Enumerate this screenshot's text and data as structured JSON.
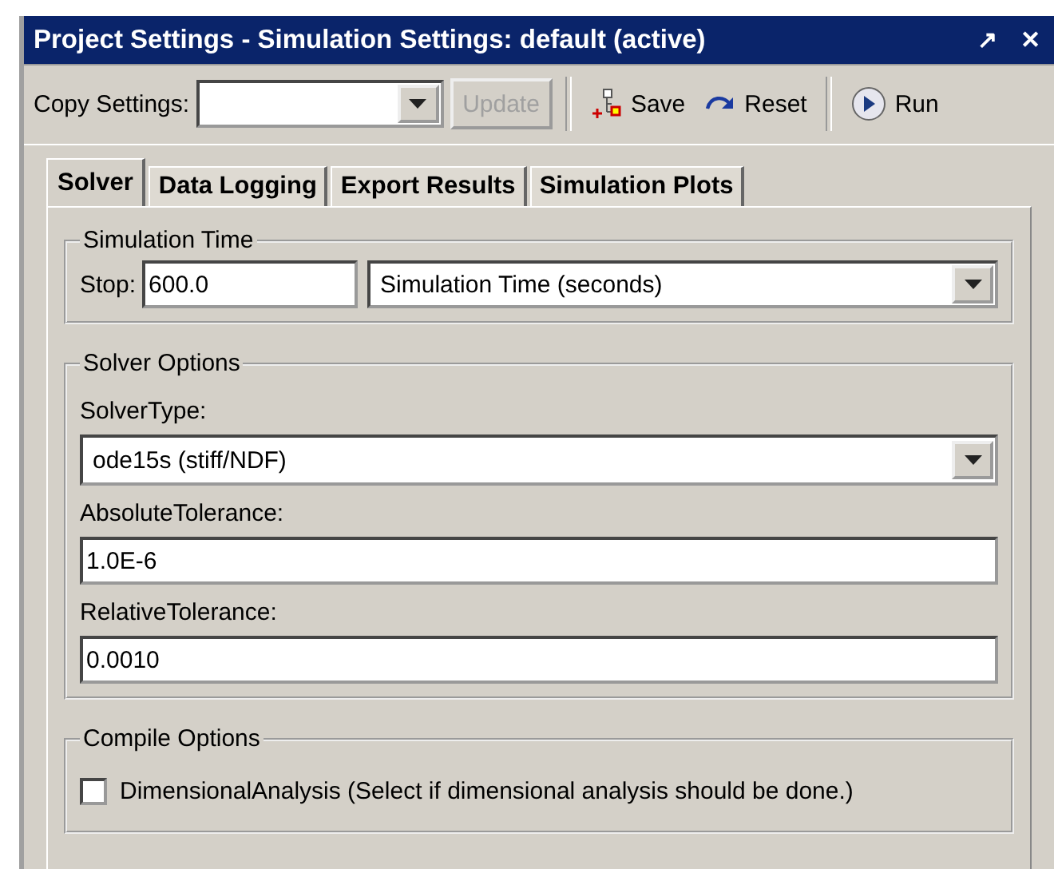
{
  "window": {
    "title": "Project Settings - Simulation Settings: default (active)",
    "controls": [
      "↗",
      "✕"
    ]
  },
  "toolbar": {
    "copy_label": "Copy Settings:",
    "update": {
      "label": "Update",
      "disabled": true
    },
    "save": "Save",
    "reset": "Reset",
    "run": "Run"
  },
  "tabs": [
    {
      "label": "Solver",
      "selected": true
    },
    {
      "label": "Data Logging",
      "selected": false
    },
    {
      "label": "Export Results",
      "selected": false
    },
    {
      "label": "Simulation Plots",
      "selected": false
    }
  ],
  "simulation_time": {
    "title": "Simulation Time",
    "stop_label": "Stop:",
    "stop_value": "600.0",
    "units": "Simulation Time (seconds)"
  },
  "solver_options": {
    "title": "Solver Options",
    "fields": [
      {
        "kind": "dropdown",
        "label": "SolverType:",
        "value": "ode15s (stiff/NDF)"
      },
      {
        "kind": "text",
        "label": "AbsoluteTolerance:",
        "value": "1.0E-6"
      },
      {
        "kind": "text",
        "label": "RelativeTolerance:",
        "value": "0.0010"
      }
    ]
  },
  "compile_options": {
    "title": "Compile Options",
    "checkbox": {
      "label": "DimensionalAnalysis (Select if dimensional analysis should be done.)",
      "checked": false
    }
  }
}
